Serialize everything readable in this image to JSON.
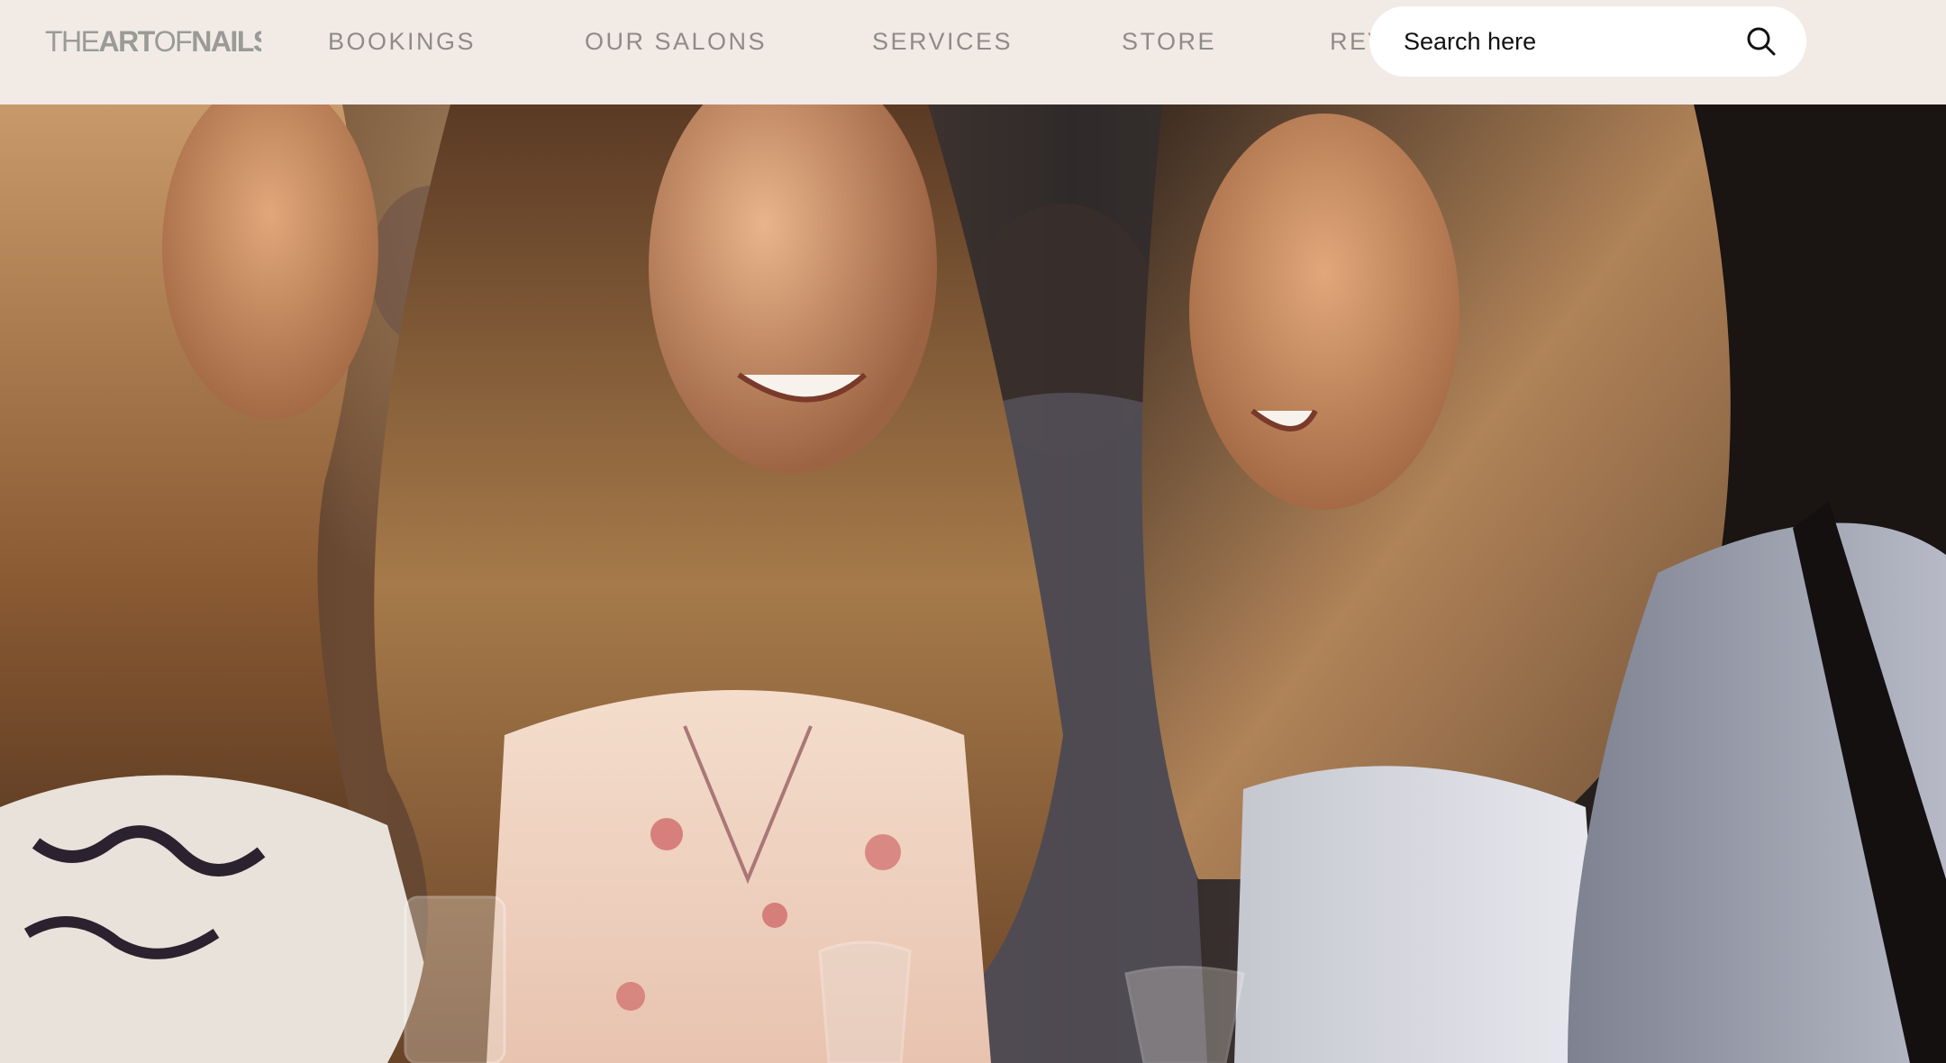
{
  "brand": {
    "logo_text_1": "THE",
    "logo_text_2": "ART",
    "logo_text_3": "OF",
    "logo_text_4": "NAILS"
  },
  "nav": {
    "items": [
      {
        "label": "BOOKINGS"
      },
      {
        "label": "OUR SALONS"
      },
      {
        "label": "SERVICES"
      },
      {
        "label": "STORE"
      },
      {
        "label": "REV"
      }
    ]
  },
  "search": {
    "placeholder": "Search here",
    "icon": "search-icon"
  },
  "hero": {
    "image": "three-women-laughing-photo"
  },
  "colors": {
    "header_bg": "#f2ebe5",
    "nav_text": "#8f8c87",
    "logo_text": "#9a9b96",
    "search_bg": "#ffffff"
  }
}
